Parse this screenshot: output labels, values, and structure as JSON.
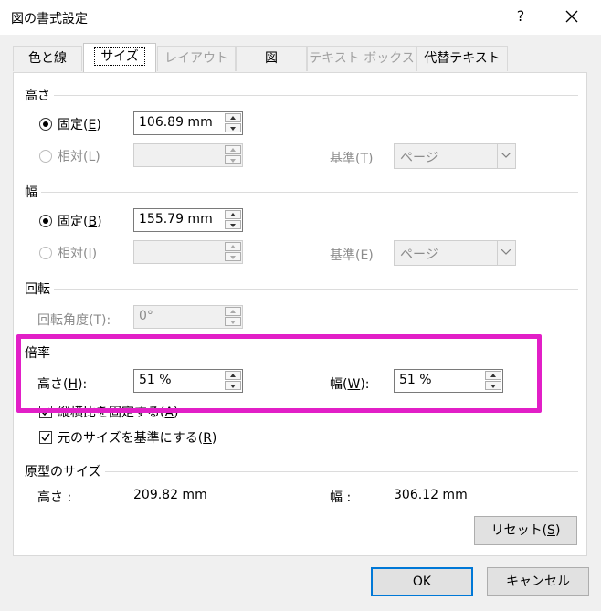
{
  "window": {
    "title": "図の書式設定",
    "help": "?",
    "close_icon": "close-icon"
  },
  "tabs": [
    {
      "label": "色と線",
      "active": false,
      "enabled": true
    },
    {
      "label": "サイズ",
      "active": true,
      "enabled": true
    },
    {
      "label": "レイアウト",
      "active": false,
      "enabled": false
    },
    {
      "label": "図",
      "active": false,
      "enabled": true
    },
    {
      "label": "テキスト ボックス",
      "active": false,
      "enabled": false
    },
    {
      "label": "代替テキスト",
      "active": false,
      "enabled": true
    }
  ],
  "height": {
    "section_title": "高さ",
    "fixed_label": "固定(",
    "fixed_key": "E",
    "fixed_suffix": ")",
    "fixed_value": "106.89 mm",
    "relative_label": "相対(L)",
    "relative_value": "",
    "base_label": "基準(T)",
    "base_value": "ページ"
  },
  "width": {
    "section_title": "幅",
    "fixed_label": "固定(",
    "fixed_key": "B",
    "fixed_suffix": ")",
    "fixed_value": "155.79 mm",
    "relative_label": "相対(I)",
    "relative_value": "",
    "base_label": "基準(E)",
    "base_value": "ページ"
  },
  "rotation": {
    "section_title": "回転",
    "angle_label": "回転角度(T):",
    "angle_value": "0°"
  },
  "scale": {
    "section_title": "倍率",
    "height_label": "高さ(",
    "height_key": "H",
    "height_suffix": "):",
    "height_value": "51 %",
    "width_label": "幅(",
    "width_key": "W",
    "width_suffix": "):",
    "width_value": "51 %",
    "lock_aspect_label": "縦横比を固定する(",
    "lock_aspect_key": "A",
    "lock_aspect_suffix": ")",
    "lock_aspect_checked": true,
    "relative_original_label": "元のサイズを基準にする(",
    "relative_original_key": "R",
    "relative_original_suffix": ")",
    "relative_original_checked": true,
    "highlight_color": "#e21fc7"
  },
  "original_size": {
    "section_title": "原型のサイズ",
    "height_label": "高さ :",
    "height_value": "209.82 mm",
    "width_label": "幅 :",
    "width_value": "306.12 mm"
  },
  "buttons": {
    "reset_label": "リセット(",
    "reset_key": "S",
    "reset_suffix": ")",
    "ok_label": "OK",
    "cancel_label": "キャンセル"
  }
}
